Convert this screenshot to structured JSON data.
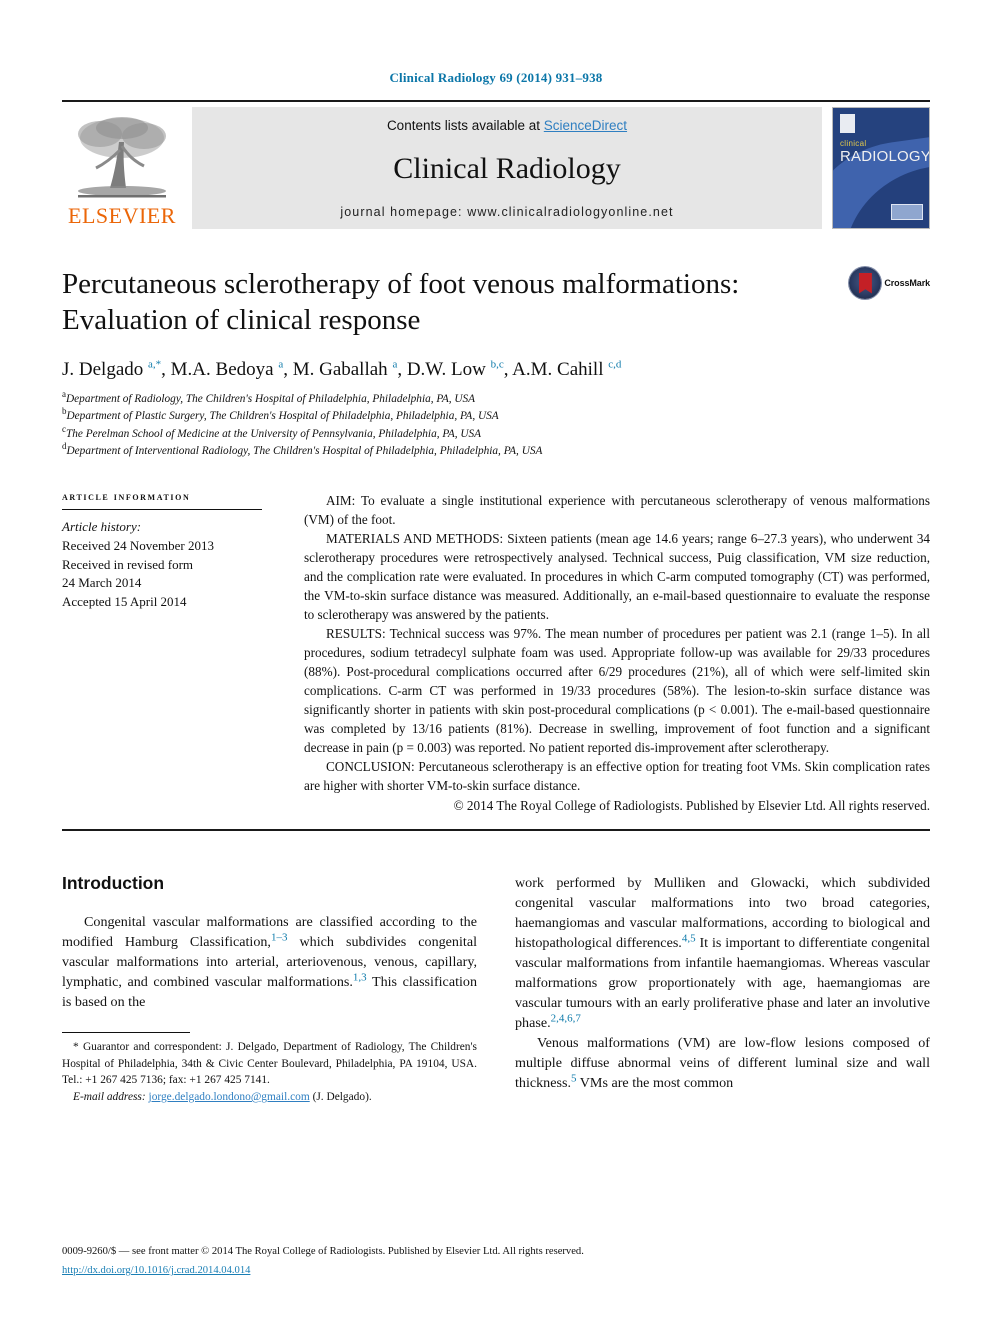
{
  "running_head": "Clinical Radiology 69 (2014) 931–938",
  "masthead": {
    "contents_prefix": "Contents lists available at ",
    "sciencedirect": "ScienceDirect",
    "journal_title": "Clinical Radiology",
    "homepage": "journal homepage: www.clinicalradiologyonline.net",
    "publisher_wordmark": "ELSEVIER",
    "cover": {
      "clinical": "clinical",
      "radiology": "RADIOLOGY"
    },
    "accent_link_color": "#2f7fc1",
    "band_color": "#e6e6e6"
  },
  "article": {
    "title": "Percutaneous sclerotherapy of foot venous malformations: Evaluation of clinical response",
    "crossmark_label": "CrossMark",
    "authors_html": "J. Delgado <sup>a,*</sup>, M.A. Bedoya <sup>a</sup>, M. Gaballah <sup>a</sup>, D.W. Low <sup>b,c</sup>, A.M. Cahill <sup>c,d</sup>",
    "affiliations": [
      "Department of Radiology, The Children's Hospital of Philadelphia, Philadelphia, PA, USA",
      "Department of Plastic Surgery, The Children's Hospital of Philadelphia, Philadelphia, PA, USA",
      "The Perelman School of Medicine at the University of Pennsylvania, Philadelphia, PA, USA",
      "Department of Interventional Radiology, The Children's Hospital of Philadelphia, Philadelphia, PA, USA"
    ],
    "affiliation_marks": [
      "a",
      "b",
      "c",
      "d"
    ]
  },
  "article_information": {
    "heading": "ARTICLE INFORMATION",
    "history_label": "Article history:",
    "history_lines": [
      "Received 24 November 2013",
      "Received in revised form",
      "24 March 2014",
      "Accepted 15 April 2014"
    ]
  },
  "abstract": {
    "aim_label": "AIM:",
    "aim_text": " To evaluate a single institutional experience with percutaneous sclerotherapy of venous malformations (VM) of the foot.",
    "methods_label": "MATERIALS AND METHODS:",
    "methods_text": " Sixteen patients (mean age 14.6 years; range 6–27.3 years), who underwent 34 sclerotherapy procedures were retrospectively analysed. Technical success, Puig classification, VM size reduction, and the complication rate were evaluated. In procedures in which C-arm computed tomography (CT) was performed, the VM-to-skin surface distance was measured. Additionally, an e-mail-based questionnaire to evaluate the response to sclerotherapy was answered by the patients.",
    "results_label": "RESULTS:",
    "results_text": " Technical success was 97%. The mean number of procedures per patient was 2.1 (range 1–5). In all procedures, sodium tetradecyl sulphate foam was used. Appropriate follow-up was available for 29/33 procedures (88%). Post-procedural complications occurred after 6/29 procedures (21%), all of which were self-limited skin complications. C-arm CT was performed in 19/33 procedures (58%). The lesion-to-skin surface distance was significantly shorter in patients with skin post-procedural complications (p < 0.001). The e-mail-based questionnaire was completed by 13/16 patients (81%). Decrease in swelling, improvement of foot function and a significant decrease in pain (p = 0.003) was reported. No patient reported dis-improvement after sclerotherapy.",
    "conclusion_label": "CONCLUSION:",
    "conclusion_text": " Percutaneous sclerotherapy is an effective option for treating foot VMs. Skin complication rates are higher with shorter VM-to-skin surface distance.",
    "copyright": "© 2014 The Royal College of Radiologists. Published by Elsevier Ltd. All rights reserved."
  },
  "introduction": {
    "heading": "Introduction",
    "left_paragraph_html": "Congenital vascular malformations are classified according to the modified Hamburg Classification,<sup class=\"ref\">1–3</sup> which subdivides congenital vascular malformations into arterial, arteriovenous, venous, capillary, lymphatic, and combined vascular malformations.<sup class=\"ref\">1,3</sup> This classification is based on the",
    "right_paragraph1_html": "work performed by Mulliken and Glowacki, which subdivided congenital vascular malformations into two broad categories, haemangiomas and vascular malformations, according to biological and histopathological differences.<sup class=\"ref\">4,5</sup> It is important to differentiate congenital vascular malformations from infantile haemangiomas. Whereas vascular malformations grow proportionately with age, haemangiomas are vascular tumours with an early proliferative phase and later an involutive phase.<sup class=\"ref\">2,4,6,7</sup>",
    "right_paragraph2_html": "Venous malformations (VM) are low-flow lesions composed of multiple diffuse abnormal veins of different luminal size and wall thickness.<sup class=\"ref\">5</sup> VMs are the most common"
  },
  "footnote": {
    "correspondence_html": "* Guarantor and correspondent: J. Delgado, Department of Radiology, The Children's Hospital of Philadelphia, 34th &amp; Civic Center Boulevard, Philadelphia, PA 19104, USA. Tel.: +1 267 425 7136; fax: +1 267 425 7141.",
    "email_label": "E-mail address:",
    "email": "jorge.delgado.londono@gmail.com",
    "email_suffix": " (J. Delgado)."
  },
  "page_footer": {
    "front_matter": "0009-9260/$ — see front matter © 2014 The Royal College of Radiologists. Published by Elsevier Ltd. All rights reserved.",
    "doi": "http://dx.doi.org/10.1016/j.crad.2014.04.014"
  }
}
